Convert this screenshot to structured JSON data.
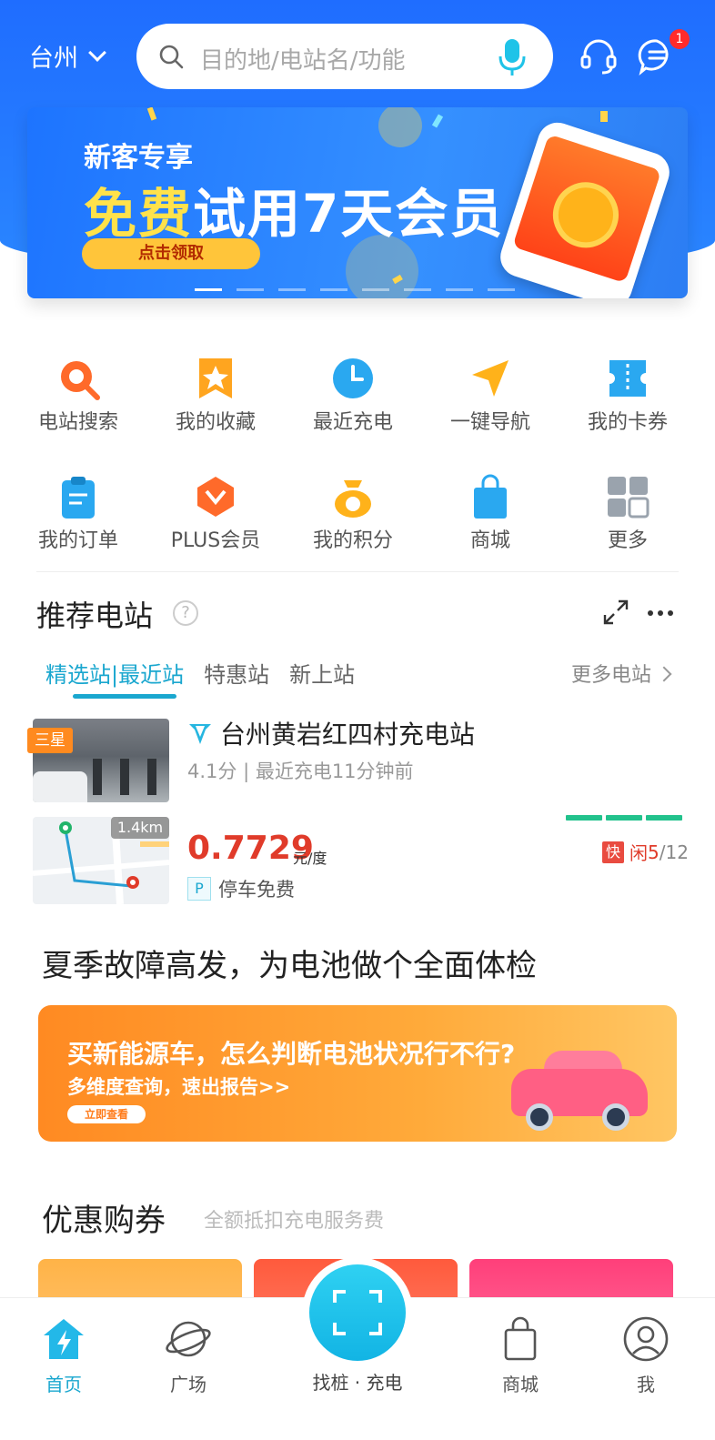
{
  "header": {
    "city": "台州",
    "search_placeholder": "目的地/电站名/功能",
    "message_badge": "1"
  },
  "banner": {
    "line1": "新客专享",
    "line2_highlight": "免费",
    "line2_rest": "试用7天会员",
    "cta": "点击领取",
    "slide_count": 8,
    "active_slide": 0
  },
  "quick_menu": [
    {
      "label": "电站搜索",
      "icon": "station-search-icon",
      "color": "#ff6a2a"
    },
    {
      "label": "我的收藏",
      "icon": "favorite-star-icon",
      "color": "#ffa51f"
    },
    {
      "label": "最近充电",
      "icon": "clock-icon",
      "color": "#2aa8f0"
    },
    {
      "label": "一键导航",
      "icon": "navigation-arrow-icon",
      "color": "#ffb21a"
    },
    {
      "label": "我的卡券",
      "icon": "coupon-icon",
      "color": "#2aa8f0"
    },
    {
      "label": "我的订单",
      "icon": "order-clipboard-icon",
      "color": "#2aa8f0"
    },
    {
      "label": "PLUS会员",
      "icon": "plus-badge-icon",
      "color": "#ff6a2a"
    },
    {
      "label": "我的积分",
      "icon": "points-bag-icon",
      "color": "#ffb21a"
    },
    {
      "label": "商城",
      "icon": "shopping-bag-icon",
      "color": "#2aa8f0"
    },
    {
      "label": "更多",
      "icon": "more-grid-icon",
      "color": "#9aa3ad"
    }
  ],
  "recommend": {
    "title": "推荐电站",
    "help": "?",
    "tabs": [
      "精选站|最近站",
      "特惠站",
      "新上站"
    ],
    "active_tab": 0,
    "more_label": "更多电站"
  },
  "station": {
    "rating_tag": "三星",
    "name": "台州黄岩红四村充电站",
    "meta": "4.1分 | 最近充电11分钟前",
    "distance": "1.4km",
    "price": "0.7729",
    "price_unit": "元/度",
    "parking_icon": "P",
    "parking": "停车免费",
    "fast_tag": "快",
    "idle_label": "闲",
    "idle_count": "5",
    "total": "/12"
  },
  "article": {
    "title": "夏季故障高发，为电池做个全面体检"
  },
  "ad": {
    "line1": "买新能源车，怎么判断电池状况行不行?",
    "line2": "多维度查询，速出报告>>",
    "button": "立即查看"
  },
  "coupons": {
    "title": "优惠购券",
    "subtitle": "全额抵扣充电服务费",
    "colors": [
      "#ffb347",
      "#ff5a3c",
      "#ff3f7a"
    ]
  },
  "nav": {
    "items": [
      {
        "label": "首页",
        "icon": "home-bolt-icon"
      },
      {
        "label": "广场",
        "icon": "planet-icon"
      },
      {
        "label": "找桩 · 充电",
        "icon": "scan-icon"
      },
      {
        "label": "商城",
        "icon": "shopping-bag-icon"
      },
      {
        "label": "我",
        "icon": "user-icon"
      }
    ],
    "active": 0
  },
  "colors": {
    "brand_blue": "#1f6dff",
    "accent_teal": "#1aa7cf",
    "price_red": "#e03b2a",
    "available_green": "#22c28c"
  }
}
